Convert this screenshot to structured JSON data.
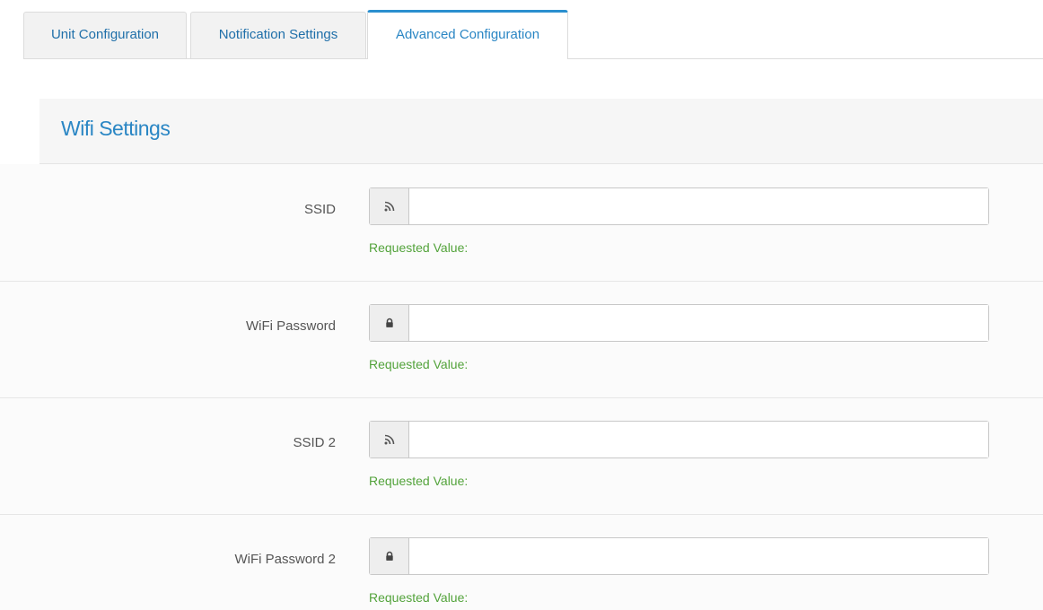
{
  "tabs": [
    {
      "label": "Unit Configuration"
    },
    {
      "label": "Notification Settings"
    },
    {
      "label": "Advanced Configuration"
    }
  ],
  "active_tab": "Advanced Configuration",
  "panel": {
    "title": "Wifi Settings"
  },
  "fields": [
    {
      "label": "SSID",
      "icon": "rss-icon",
      "value": "",
      "requested_label": "Requested Value:",
      "requested_value": ""
    },
    {
      "label": "WiFi Password",
      "icon": "lock-icon",
      "value": "",
      "requested_label": "Requested Value:",
      "requested_value": ""
    },
    {
      "label": "SSID 2",
      "icon": "rss-icon",
      "value": "",
      "requested_label": "Requested Value:",
      "requested_value": ""
    },
    {
      "label": "WiFi Password 2",
      "icon": "lock-icon",
      "value": "",
      "requested_label": "Requested Value:",
      "requested_value": ""
    }
  ],
  "colors": {
    "accent": "#2a86c4",
    "success_text": "#53a33b",
    "header_bg": "#f6f6f6"
  }
}
